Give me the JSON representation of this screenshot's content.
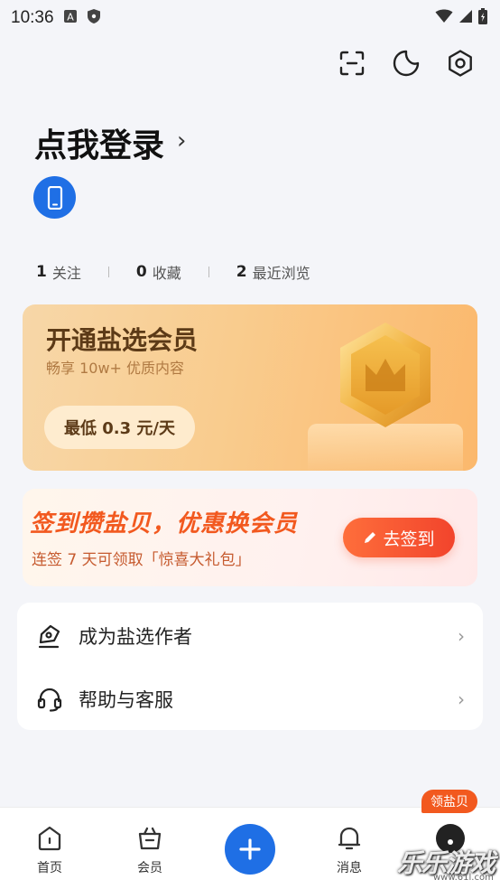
{
  "status_bar": {
    "time": "10:36"
  },
  "login": {
    "title": "点我登录",
    "arrow": "›"
  },
  "stats": [
    {
      "count": "1",
      "label": "关注"
    },
    {
      "count": "0",
      "label": "收藏"
    },
    {
      "count": "2",
      "label": "最近浏览"
    }
  ],
  "vip": {
    "title": "开通盐选会员",
    "subtitle": "畅享 10w+ 优质内容",
    "price_button": "最低 0.3 元/天"
  },
  "signin": {
    "title": "签到攒盐贝，优惠换会员",
    "subtitle": "连签 7 天可领取「惊喜大礼包」",
    "button": "去签到"
  },
  "menu": [
    {
      "label": "成为盐选作者",
      "icon": "pen-icon"
    },
    {
      "label": "帮助与客服",
      "icon": "headset-icon"
    }
  ],
  "tabbar": {
    "home": "首页",
    "vip": "会员",
    "messages": "消息",
    "reward_pill": "领盐贝"
  },
  "watermark": {
    "text": "乐乐游戏",
    "url": "www.61l.com"
  },
  "colors": {
    "accent_blue": "#1f6fe5",
    "signin_orange": "#f2591f",
    "vip_gold": "#f9cc8e"
  }
}
